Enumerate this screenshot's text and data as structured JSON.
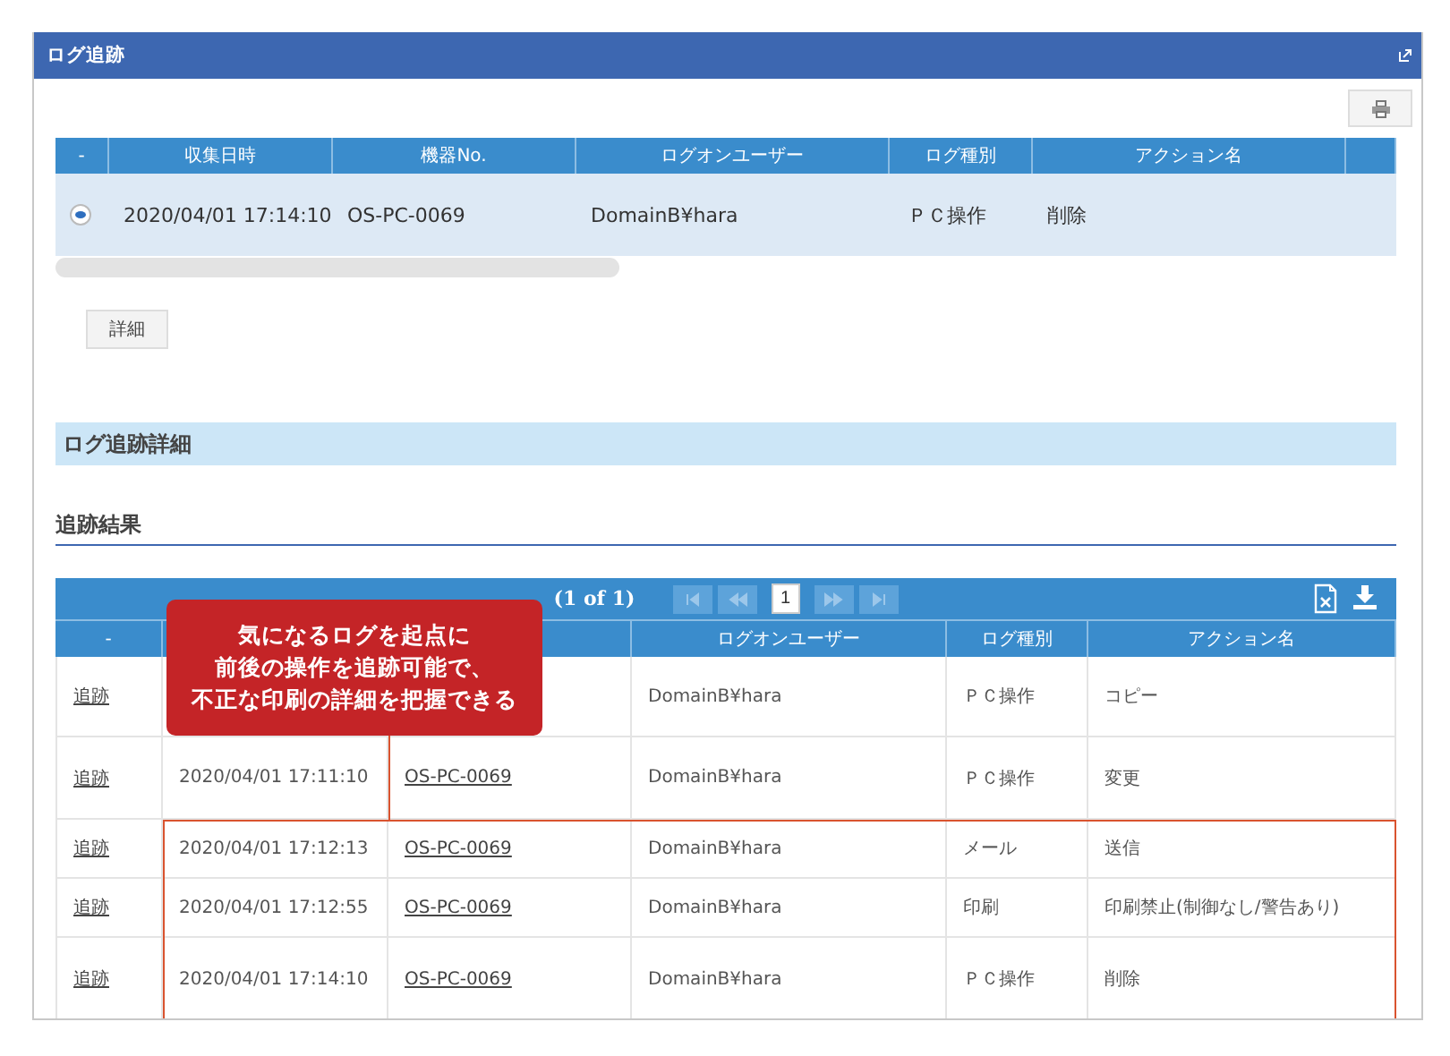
{
  "window": {
    "title": "ログ追跡"
  },
  "top_table": {
    "columns": [
      {
        "label": "-"
      },
      {
        "label": "収集日時"
      },
      {
        "label": "機器No."
      },
      {
        "label": "ログオンユーザー"
      },
      {
        "label": "ログ種別"
      },
      {
        "label": "アクション名"
      }
    ],
    "rows": [
      {
        "selected": true,
        "date": "2020/04/01 17:14:10",
        "device": "OS-PC-0069",
        "user": "DomainB¥hara",
        "type": "ＰＣ操作",
        "action": "削除"
      }
    ]
  },
  "detail_button": "詳細",
  "section_title": "ログ追跡詳細",
  "subsection_title": "追跡結果",
  "result_table": {
    "pager": {
      "summary": "(1 of 1)",
      "nav": [
        {
          "kind": "first",
          "disabled": true
        },
        {
          "kind": "prev",
          "disabled": true
        },
        {
          "kind": "page",
          "label": "1",
          "selected": true
        },
        {
          "kind": "next",
          "disabled": true
        },
        {
          "kind": "last",
          "disabled": true
        }
      ]
    },
    "columns": [
      {
        "label": "-"
      },
      {},
      {},
      {
        "label": "ログオンユーザー"
      },
      {
        "label": "ログ種別"
      },
      {
        "label": "アクション名"
      }
    ],
    "rows": [
      {
        "link": "追跡",
        "user": "DomainB¥hara",
        "type": "ＰＣ操作",
        "action": "コピー",
        "highlighted": false
      },
      {
        "link": "追跡",
        "date": "2020/04/01 17:11:10",
        "device": "OS-PC-0069",
        "user": "DomainB¥hara",
        "type": "ＰＣ操作",
        "action": "変更",
        "highlighted": false
      },
      {
        "link": "追跡",
        "date": "2020/04/01 17:12:13",
        "device": "OS-PC-0069",
        "user": "DomainB¥hara",
        "type": "メール",
        "action": "送信",
        "highlighted": true
      },
      {
        "link": "追跡",
        "date": "2020/04/01 17:12:55",
        "device": "OS-PC-0069",
        "user": "DomainB¥hara",
        "type": "印刷",
        "action": "印刷禁止(制御なし/警告あり)",
        "highlighted": true
      },
      {
        "link": "追跡",
        "date": "2020/04/01 17:14:10",
        "device": "OS-PC-0069",
        "user": "DomainB¥hara",
        "type": "ＰＣ操作",
        "action": "削除",
        "highlighted": true
      }
    ]
  },
  "callout": {
    "lines": [
      "気になるログを起点に",
      "前後の操作を追跡可能で、",
      "不正な印刷の詳細を把握できる"
    ]
  }
}
